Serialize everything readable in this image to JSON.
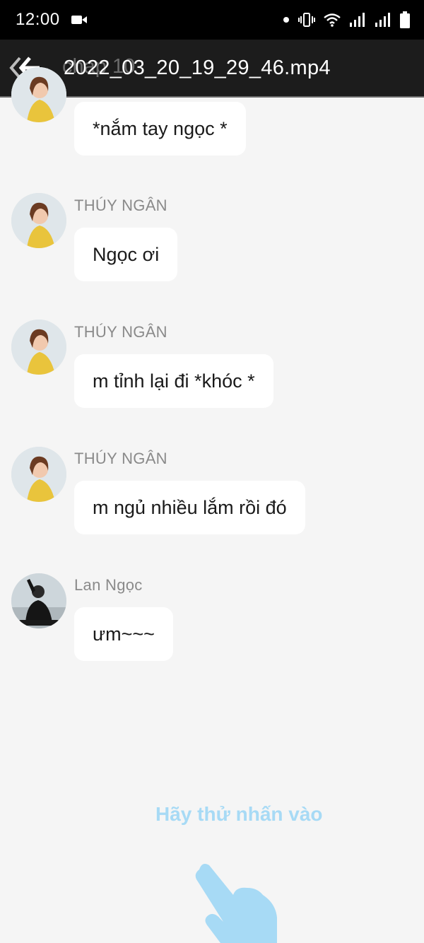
{
  "status_bar": {
    "time": "12:00",
    "icons": [
      "video-camera-icon",
      "dot-icon",
      "vibrate-icon",
      "wifi-icon",
      "signal-icon",
      "signal-icon",
      "battery-icon"
    ]
  },
  "title_bar": {
    "back_icon": "back-arrow-icon",
    "watermark": "chap 10",
    "title": "2022_03_20_19_29_46.mp4"
  },
  "messages": [
    {
      "sender": "",
      "text": "*nắm tay ngọc *",
      "avatar": "avatar-thuy-ngan"
    },
    {
      "sender": "THÚY NGÂN",
      "text": "Ngọc ơi",
      "avatar": "avatar-thuy-ngan"
    },
    {
      "sender": "THÚY NGÂN",
      "text": "m tỉnh lại đi *khóc *",
      "avatar": "avatar-thuy-ngan"
    },
    {
      "sender": "THÚY NGÂN",
      "text": "m ngủ nhiều lắm rồi đó",
      "avatar": "avatar-thuy-ngan"
    },
    {
      "sender": "Lan Ngọc",
      "text": "ưm~~~",
      "avatar": "avatar-lan-ngoc"
    }
  ],
  "hint": {
    "text": "Hãy thử nhấn vào",
    "icon": "tap-hand-icon"
  },
  "colors": {
    "background": "#f5f5f5",
    "hint": "#a7daf5",
    "sender": "#8a8a8a"
  }
}
